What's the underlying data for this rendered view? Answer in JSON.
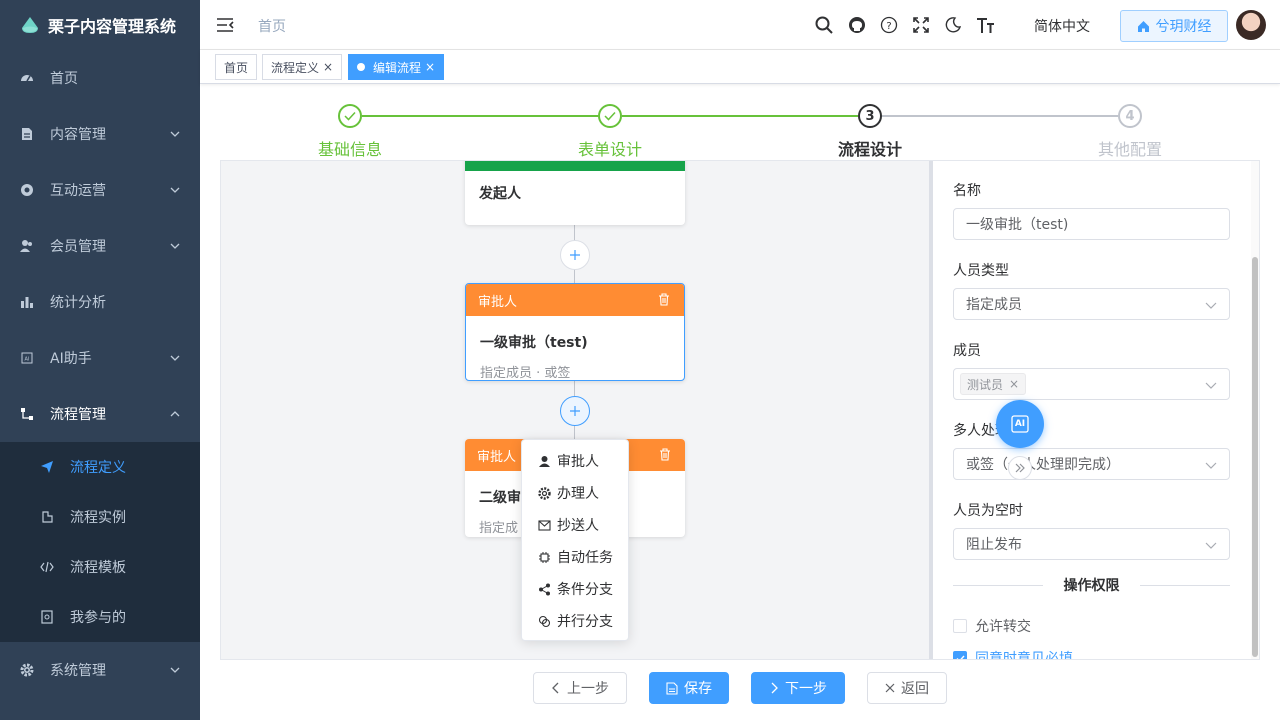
{
  "app": {
    "title": "栗子内容管理系统"
  },
  "sidebar": {
    "items": [
      {
        "label": "首页",
        "icon": "dashboard-icon"
      },
      {
        "label": "内容管理",
        "icon": "document-icon"
      },
      {
        "label": "互动运营",
        "icon": "target-icon"
      },
      {
        "label": "会员管理",
        "icon": "users-icon"
      },
      {
        "label": "统计分析",
        "icon": "bar-chart-icon"
      },
      {
        "label": "AI助手",
        "icon": "ai-icon"
      },
      {
        "label": "流程管理",
        "icon": "workflow-icon"
      },
      {
        "label": "系统管理",
        "icon": "gear-icon"
      }
    ],
    "subitems": [
      {
        "label": "流程定义",
        "icon": "send-icon",
        "active": true
      },
      {
        "label": "流程实例",
        "icon": "flow-instance-icon"
      },
      {
        "label": "流程模板",
        "icon": "code-icon"
      },
      {
        "label": "我参与的",
        "icon": "participate-icon"
      }
    ]
  },
  "navbar": {
    "breadcrumb": "首页",
    "language": "简体中文",
    "tenant": "兮玥财经"
  },
  "tags": [
    {
      "label": "首页"
    },
    {
      "label": "流程定义"
    },
    {
      "label": "编辑流程"
    }
  ],
  "steps": [
    {
      "label": "基础信息",
      "number": "1",
      "state": "finished"
    },
    {
      "label": "表单设计",
      "number": "2",
      "state": "finished"
    },
    {
      "label": "流程设计",
      "number": "3",
      "state": "current"
    },
    {
      "label": "其他配置",
      "number": "4",
      "state": "pending"
    }
  ],
  "flow": {
    "start_node": {
      "title": "发起人"
    },
    "node1": {
      "type": "审批人",
      "title": "一级审批（test)",
      "sub": "指定成员 · 或签"
    },
    "node2": {
      "type": "审批人",
      "title": "二级审",
      "sub": "指定成"
    },
    "add_menu": [
      {
        "label": "审批人",
        "icon": "user-icon"
      },
      {
        "label": "办理人",
        "icon": "gear-icon"
      },
      {
        "label": "抄送人",
        "icon": "mail-icon"
      },
      {
        "label": "自动任务",
        "icon": "chip-icon"
      },
      {
        "label": "条件分支",
        "icon": "share-icon"
      },
      {
        "label": "并行分支",
        "icon": "parallel-icon"
      }
    ]
  },
  "panel": {
    "name_label": "名称",
    "name_value": "一级审批（test)",
    "type_label": "人员类型",
    "type_value": "指定成员",
    "member_label": "成员",
    "member_tag": "测试员",
    "multi_label": "多人处理方式",
    "multi_value": "或签（一人处理即完成）",
    "empty_label": "人员为空时",
    "empty_value": "阻止发布",
    "perm_title": "操作权限",
    "perm_transfer": "允许转交",
    "perm_comment": "同意时意见必填"
  },
  "ai_fab": "AI",
  "footer": {
    "prev": "上一步",
    "save": "保存",
    "next": "下一步",
    "back": "返回"
  },
  "colors": {
    "primary": "#409eff",
    "success": "#67c23a",
    "warning": "#ff8c33",
    "start_green": "#16a34a",
    "sidebar_bg": "#304156",
    "submenu_bg": "#1f2d3d"
  }
}
